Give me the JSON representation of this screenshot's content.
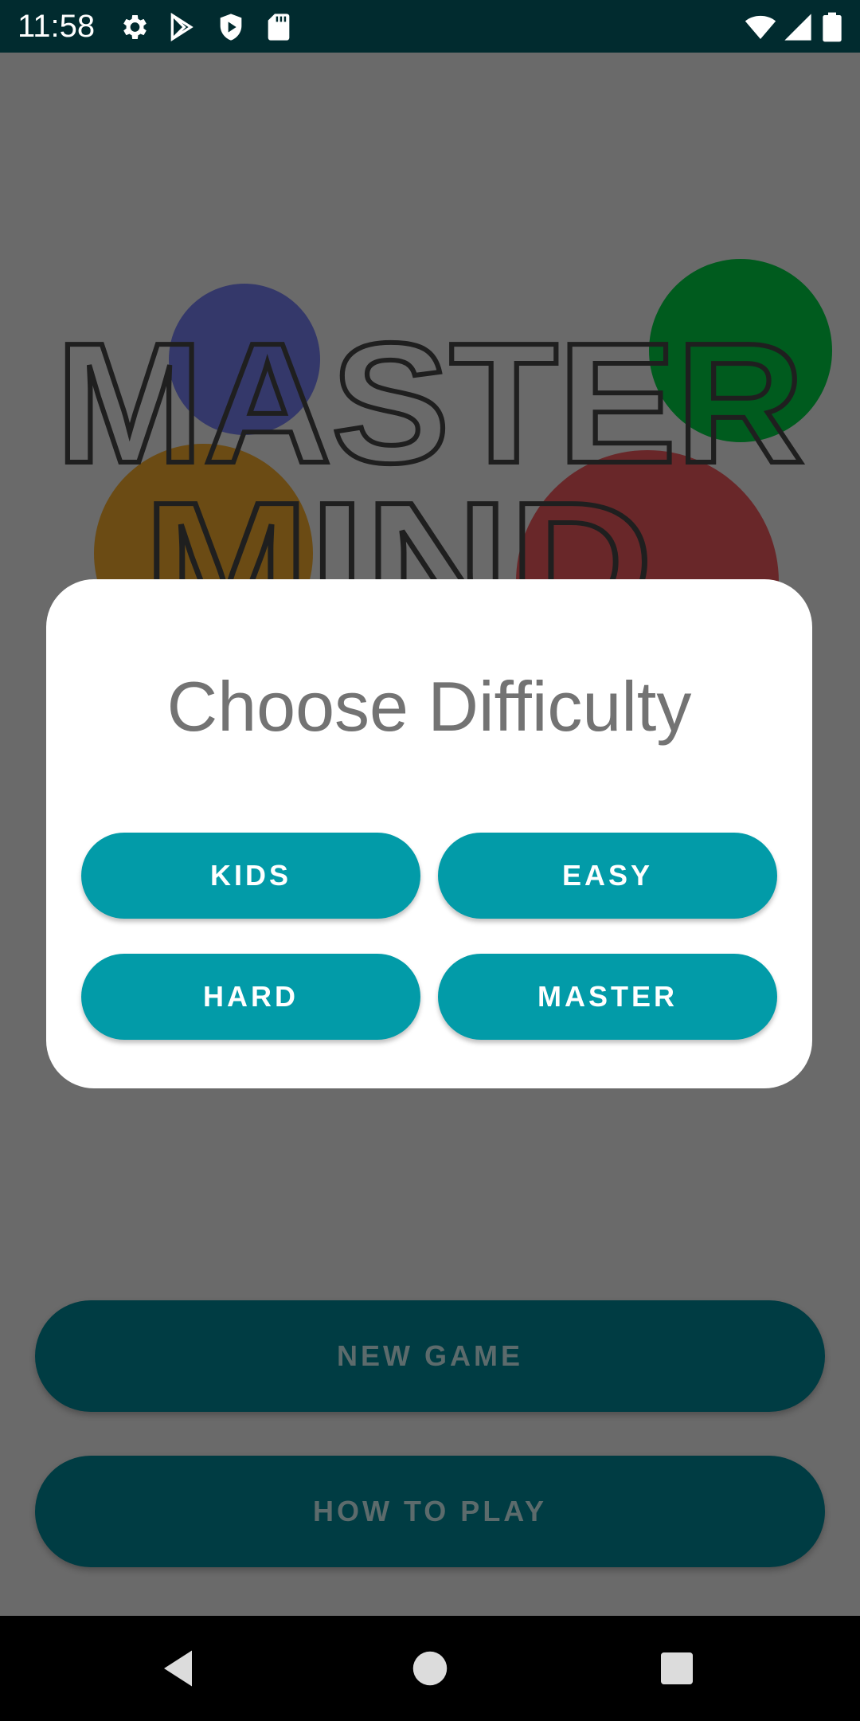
{
  "status_bar": {
    "time": "11:58",
    "left_icons": [
      "gear-icon",
      "play-store-icon",
      "shield-play-icon",
      "sd-card-icon"
    ],
    "right_icons": [
      "wifi-icon",
      "signal-icon",
      "battery-icon"
    ]
  },
  "background": {
    "logo_line1": "MASTER",
    "logo_line2": "MIND",
    "dot_colors": [
      "#34386a",
      "#005b1e",
      "#6b4b14",
      "#692729"
    ],
    "new_game_label": "NEW GAME",
    "how_to_play_label": "HOW TO PLAY"
  },
  "dialog": {
    "title": "Choose Difficulty",
    "options": [
      {
        "label": "KIDS"
      },
      {
        "label": "EASY"
      },
      {
        "label": "HARD"
      },
      {
        "label": "MASTER"
      }
    ],
    "button_color": "#029ba8"
  },
  "nav_bar": {
    "icons": [
      "back-icon",
      "home-icon",
      "recents-icon"
    ]
  },
  "colors": {
    "scrim": "#6a6a6a",
    "status_bar": "#012b2f",
    "main_button": "#003c43"
  }
}
